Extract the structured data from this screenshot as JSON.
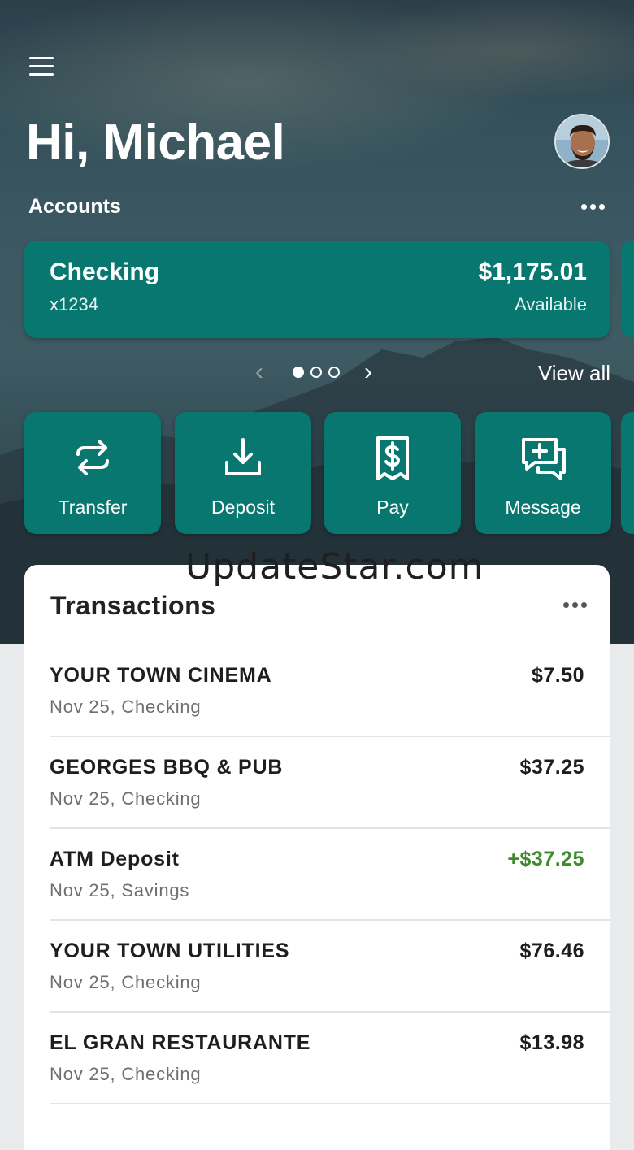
{
  "header": {
    "menu_icon": "hamburger-menu-icon",
    "greeting": "Hi, Michael",
    "avatar_icon": "user-avatar"
  },
  "accounts": {
    "label": "Accounts",
    "more_icon": "more-horizontal-icon",
    "card": {
      "name": "Checking",
      "number": "x1234",
      "balance": "$1,175.01",
      "balance_label": "Available"
    },
    "pager": {
      "prev_icon": "chevron-left-icon",
      "next_icon": "chevron-right-icon",
      "dots": 3,
      "active_dot": 0,
      "prev_glyph": "‹",
      "next_glyph": "›"
    },
    "view_all": "View all"
  },
  "actions": [
    {
      "label": "Transfer",
      "icon": "transfer-arrows-icon"
    },
    {
      "label": "Deposit",
      "icon": "download-tray-icon"
    },
    {
      "label": "Pay",
      "icon": "receipt-dollar-icon"
    },
    {
      "label": "Message",
      "icon": "message-plus-icon"
    }
  ],
  "watermark": "UpdateStar.com",
  "transactions": {
    "title": "Transactions",
    "more_icon": "more-horizontal-icon",
    "items": [
      {
        "merchant": "YOUR TOWN CINEMA",
        "meta": "Nov 25, Checking",
        "amount": "$7.50",
        "credit": false
      },
      {
        "merchant": "GEORGES BBQ & PUB",
        "meta": "Nov 25, Checking",
        "amount": "$37.25",
        "credit": false
      },
      {
        "merchant": "ATM Deposit",
        "meta": "Nov 25, Savings",
        "amount": "+$37.25",
        "credit": true
      },
      {
        "merchant": "YOUR TOWN UTILITIES",
        "meta": "Nov 25, Checking",
        "amount": "$76.46",
        "credit": false
      },
      {
        "merchant": "EL GRAN RESTAURANTE",
        "meta": "Nov 25, Checking",
        "amount": "$13.98",
        "credit": false
      }
    ]
  },
  "colors": {
    "brand_teal": "#08776f",
    "credit_green": "#3d8b2a",
    "text_dark": "#1e1e1e",
    "text_muted": "#6e6e6e"
  }
}
